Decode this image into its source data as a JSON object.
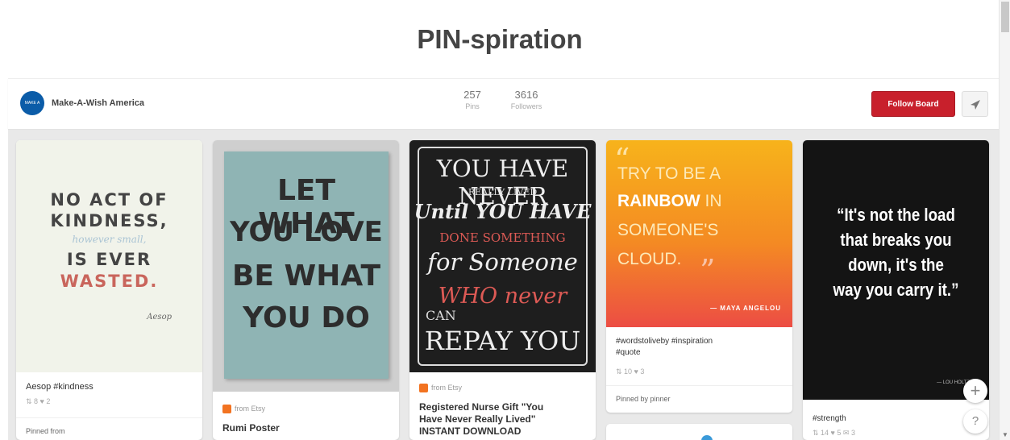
{
  "page_title": "PIN-spiration",
  "board": {
    "owner_name": "Make-A-Wish America",
    "avatar_text": "MAKE A WISH",
    "pins_count": "257",
    "pins_label": "Pins",
    "followers_count": "3616",
    "followers_label": "Followers",
    "follow_button": "Follow Board",
    "send_icon": "paper-plane-icon"
  },
  "pins": [
    {
      "quote_lines": [
        "NO ACT OF",
        "KINDNESS,",
        "however small,",
        "IS EVER",
        "WASTED."
      ],
      "quote_author": "Aesop",
      "description": "Aesop #kindness",
      "stats": "⇅ 8   ♥ 2",
      "pinned_from": "Pinned from"
    },
    {
      "quote_lines": [
        "LET WHAT",
        "YOU LOVE",
        "BE WHAT",
        "YOU DO"
      ],
      "from": "from Etsy",
      "title": "Rumi Poster"
    },
    {
      "quote_lines": [
        "YOU HAVE NEVER",
        "REALLY LIVED",
        "Until YOU HAVE",
        "DONE SOMETHING",
        "for Someone",
        "WHO never",
        "CAN",
        "REPAY YOU"
      ],
      "from": "from Etsy",
      "title_lines": [
        "Registered Nurse Gift \"You",
        "Have Never Really Lived\"",
        "INSTANT DOWNLOAD"
      ]
    },
    {
      "quote_lines": [
        "TRY TO BE A",
        "RAINBOW IN",
        "SOMEONE'S",
        "CLOUD."
      ],
      "quote_highlight": "RAINBOW",
      "quote_author": "— MAYA ANGELOU",
      "description_lines": [
        "#wordstoliveby #inspiration",
        "#quote"
      ],
      "stats": "⇅ 10   ♥ 3",
      "pinned_by": "Pinned by pinner"
    },
    {
      "quote_lines": [
        "“It's not the load",
        "that breaks you",
        "down, it's the",
        "way you carry it.”"
      ],
      "quote_author": "— LOU HOLTZ",
      "description": "#strength",
      "stats": "⇅ 14   ♥ 5   ✉ 3"
    }
  ],
  "floating": {
    "add_button": "+",
    "help_button": "?"
  },
  "colors": {
    "accent_red": "#c8202c",
    "brand_blue": "#0b5ca8",
    "rainbow_orange": "#f7a21b"
  }
}
